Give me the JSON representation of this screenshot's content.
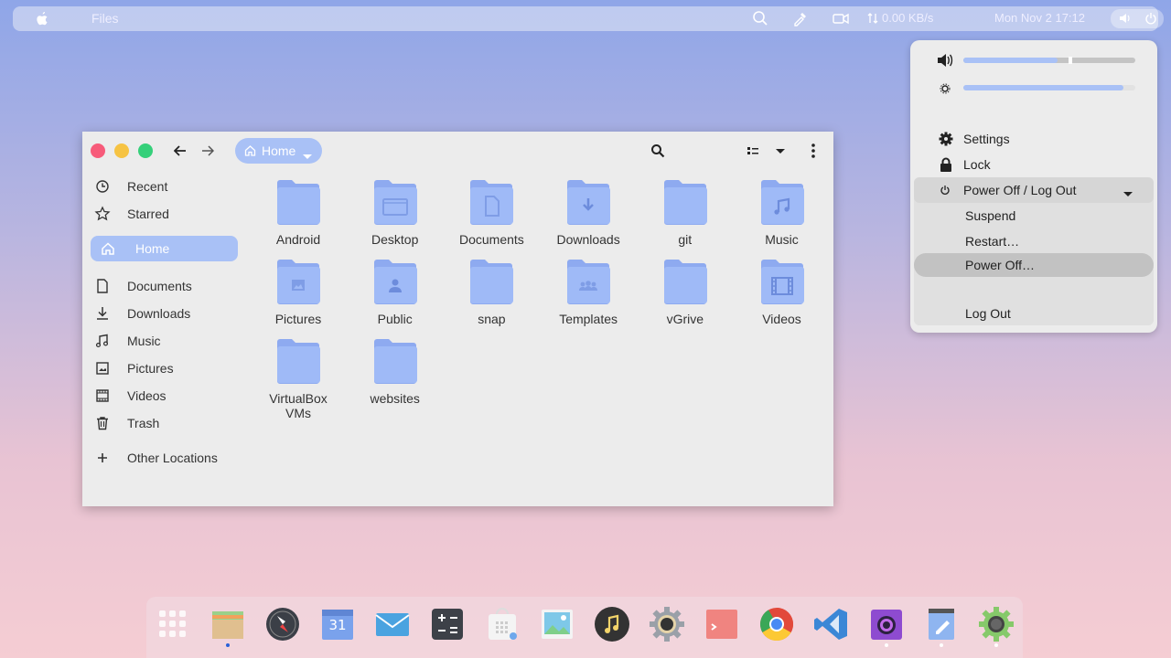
{
  "topbar": {
    "app_name": "Files",
    "network": "0.00 KB/s",
    "clock": "Mon Nov 2  17:12"
  },
  "system_menu": {
    "volume_level": 0.55,
    "brightness_level": 0.93,
    "settings": "Settings",
    "lock": "Lock",
    "power_header": "Power Off / Log Out",
    "suspend": "Suspend",
    "restart": "Restart…",
    "power_off": "Power Off…",
    "log_out": "Log Out"
  },
  "window": {
    "path_label": "Home",
    "sidebar": [
      {
        "label": "Recent",
        "icon": "clock-icon"
      },
      {
        "label": "Starred",
        "icon": "star-icon"
      },
      {
        "label": "Home",
        "icon": "home-icon"
      },
      {
        "label": "Documents",
        "icon": "document-icon"
      },
      {
        "label": "Downloads",
        "icon": "download-icon"
      },
      {
        "label": "Music",
        "icon": "music-icon"
      },
      {
        "label": "Pictures",
        "icon": "picture-icon"
      },
      {
        "label": "Videos",
        "icon": "video-icon"
      },
      {
        "label": "Trash",
        "icon": "trash-icon"
      },
      {
        "label": "Other Locations",
        "icon": "plus-icon"
      }
    ],
    "folders": [
      {
        "label": "Android",
        "emblem": ""
      },
      {
        "label": "Desktop",
        "emblem": "desktop"
      },
      {
        "label": "Documents",
        "emblem": "document"
      },
      {
        "label": "Downloads",
        "emblem": "download"
      },
      {
        "label": "git",
        "emblem": ""
      },
      {
        "label": "Music",
        "emblem": "music"
      },
      {
        "label": "Pictures",
        "emblem": "picture"
      },
      {
        "label": "Public",
        "emblem": "person"
      },
      {
        "label": "snap",
        "emblem": ""
      },
      {
        "label": "Templates",
        "emblem": "group"
      },
      {
        "label": "vGrive",
        "emblem": ""
      },
      {
        "label": "Videos",
        "emblem": "film"
      },
      {
        "label": "VirtualBox VMs",
        "emblem": ""
      },
      {
        "label": "websites",
        "emblem": ""
      }
    ]
  },
  "dock": {
    "calendar_day": "31",
    "items": [
      "app-grid-icon",
      "files-icon",
      "safari-compass-icon",
      "calendar-icon",
      "mail-icon",
      "calculator-icon",
      "software-store-icon",
      "image-viewer-icon",
      "music-player-icon",
      "settings-gear-icon",
      "terminal-icon",
      "chrome-icon",
      "vscode-icon",
      "camera-icon",
      "text-editor-icon",
      "tweaks-gear-icon"
    ]
  },
  "colors": {
    "accent": "#a9c1f6",
    "folder": "#9fbaf7",
    "folder_tab": "#8eaaf0",
    "close": "#f75b7a",
    "minimize": "#f6c343",
    "maximize": "#35d07a"
  }
}
